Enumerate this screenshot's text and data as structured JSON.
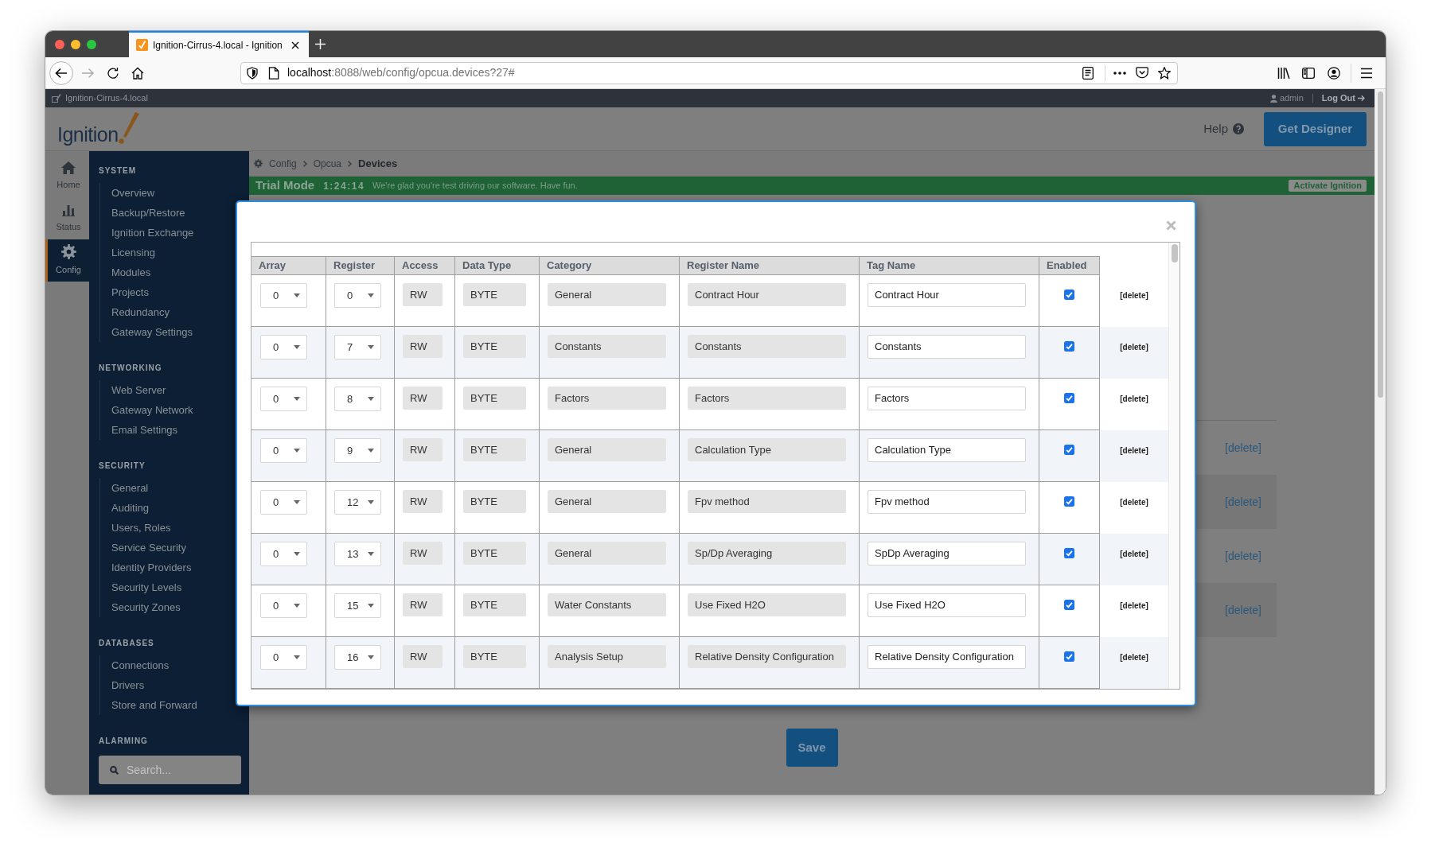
{
  "browser": {
    "tab_title": "Ignition-Cirrus-4.local - Ignition",
    "url_host": "localhost",
    "url_rest": ":8088/web/config/opcua.devices?27#"
  },
  "top_bar": {
    "gateway": "Ignition-Cirrus-4.local",
    "user": "admin",
    "logout": "Log Out"
  },
  "header": {
    "logo": "Ignition",
    "help": "Help",
    "get_designer": "Get Designer"
  },
  "nav_rail": [
    {
      "kind": "home",
      "label": "Home",
      "selected": false
    },
    {
      "kind": "status",
      "label": "Status",
      "selected": false
    },
    {
      "kind": "config",
      "label": "Config",
      "selected": true
    }
  ],
  "sidebar": {
    "sections": [
      {
        "title": "SYSTEM",
        "items": [
          "Overview",
          "Backup/Restore",
          "Ignition Exchange",
          "Licensing",
          "Modules",
          "Projects",
          "Redundancy",
          "Gateway Settings"
        ]
      },
      {
        "title": "NETWORKING",
        "items": [
          "Web Server",
          "Gateway Network",
          "Email Settings"
        ]
      },
      {
        "title": "SECURITY",
        "items": [
          "General",
          "Auditing",
          "Users, Roles",
          "Service Security",
          "Identity Providers",
          "Security Levels",
          "Security Zones"
        ]
      },
      {
        "title": "DATABASES",
        "items": [
          "Connections",
          "Drivers",
          "Store and Forward"
        ]
      },
      {
        "title": "ALARMING"
      }
    ],
    "search": {
      "placeholder": "Search..."
    }
  },
  "breadcrumb": [
    {
      "label": "Config",
      "current": false
    },
    {
      "label": "Opcua",
      "current": false
    },
    {
      "label": "Devices",
      "current": true
    }
  ],
  "trial_bar": {
    "title": "Trial Mode",
    "timer": "1:24:14",
    "message": "We're glad you're test driving our software. Have fun.",
    "action": "Activate Ignition"
  },
  "background_table": {
    "rows": [
      {
        "action": "[delete]"
      },
      {
        "action": "[delete]"
      },
      {
        "action": "[delete]"
      },
      {
        "action": "[delete]"
      }
    ]
  },
  "save_button": "Save",
  "modal": {
    "table": {
      "columns": [
        {
          "label": "Array",
          "kind": "select"
        },
        {
          "label": "Register",
          "kind": "select"
        },
        {
          "label": "Access",
          "kind": "readonly"
        },
        {
          "label": "Data Type",
          "kind": "readonly"
        },
        {
          "label": "Category",
          "kind": "readonly"
        },
        {
          "label": "Register Name",
          "kind": "readonly"
        },
        {
          "label": "Tag Name",
          "kind": "input"
        },
        {
          "label": "Enabled",
          "kind": "checkbox"
        }
      ],
      "rows": [
        {
          "values": [
            "0",
            "0",
            "RW",
            "BYTE",
            "General",
            "Contract Hour",
            "Contract Hour"
          ],
          "enabled": true,
          "action": "[delete]"
        },
        {
          "values": [
            "0",
            "7",
            "RW",
            "BYTE",
            "Constants",
            "Constants",
            "Constants"
          ],
          "enabled": true,
          "action": "[delete]"
        },
        {
          "values": [
            "0",
            "8",
            "RW",
            "BYTE",
            "Factors",
            "Factors",
            "Factors"
          ],
          "enabled": true,
          "action": "[delete]"
        },
        {
          "values": [
            "0",
            "9",
            "RW",
            "BYTE",
            "General",
            "Calculation Type",
            "Calculation Type"
          ],
          "enabled": true,
          "action": "[delete]"
        },
        {
          "values": [
            "0",
            "12",
            "RW",
            "BYTE",
            "General",
            "Fpv method",
            "Fpv method"
          ],
          "enabled": true,
          "action": "[delete]"
        },
        {
          "values": [
            "0",
            "13",
            "RW",
            "BYTE",
            "General",
            "Sp/Dp Averaging",
            "SpDp Averaging"
          ],
          "enabled": true,
          "action": "[delete]"
        },
        {
          "values": [
            "0",
            "15",
            "RW",
            "BYTE",
            "Water Constants",
            "Use Fixed H2O",
            "Use Fixed H2O"
          ],
          "enabled": true,
          "action": "[delete]"
        },
        {
          "values": [
            "0",
            "16",
            "RW",
            "BYTE",
            "Analysis Setup",
            "Relative Density Configuration",
            "Relative Density Configuration"
          ],
          "enabled": true,
          "action": "[delete]"
        }
      ]
    }
  }
}
